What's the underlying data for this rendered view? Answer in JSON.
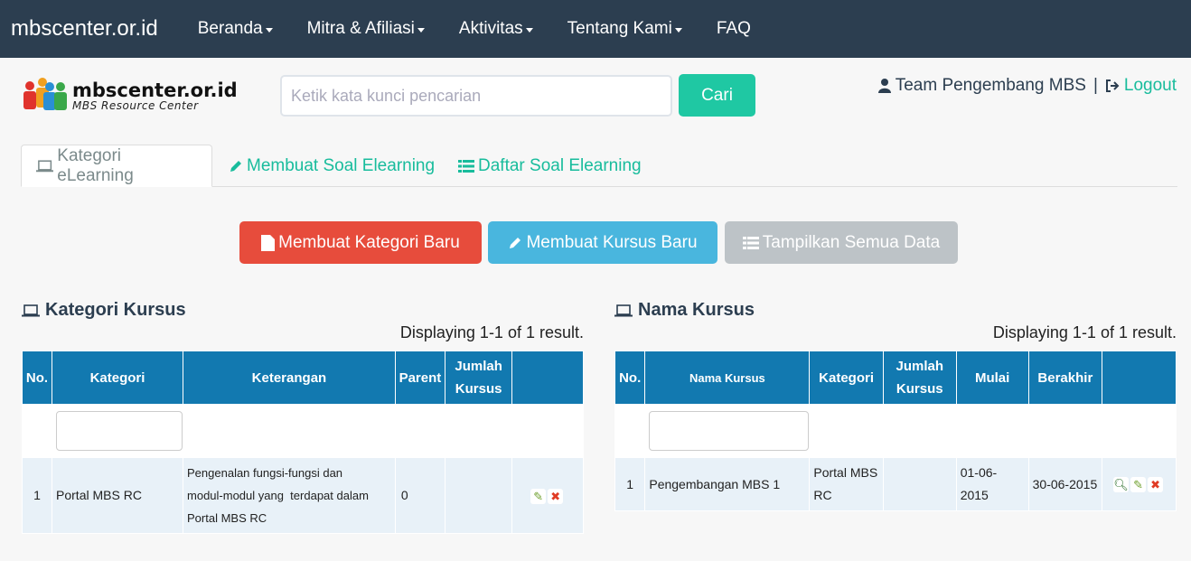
{
  "nav": {
    "brand": "mbscenter.or.id",
    "items": [
      {
        "label": "Beranda",
        "dropdown": true
      },
      {
        "label": "Mitra & Afiliasi",
        "dropdown": true
      },
      {
        "label": "Aktivitas",
        "dropdown": true
      },
      {
        "label": "Tentang Kami",
        "dropdown": true
      },
      {
        "label": "FAQ",
        "dropdown": false
      }
    ]
  },
  "header": {
    "logo_title": "mbscenter.or.id",
    "logo_sub": "MBS Resource Center",
    "search_placeholder": "Ketik kata kunci pencarian",
    "search_button": "Cari",
    "user_name": "Team Pengembang MBS",
    "separator": "|",
    "logout": "Logout"
  },
  "tabs": [
    {
      "label": "Kategori eLearning",
      "active": true,
      "icon": "laptop-icon"
    },
    {
      "label": "Membuat Soal Elearning",
      "active": false,
      "icon": "pencil-icon"
    },
    {
      "label": "Daftar Soal Elearning",
      "active": false,
      "icon": "list-icon"
    }
  ],
  "actions": {
    "new_category": "Membuat Kategori Baru",
    "new_course": "Membuat Kursus Baru",
    "show_all": "Tampilkan Semua Data"
  },
  "colors": {
    "navbar": "#2c3e50",
    "accent": "#18bc9c",
    "table_header": "#1279b0",
    "danger": "#e74c3c",
    "info": "#49b6de",
    "muted": "#bdc3c7"
  },
  "kategori": {
    "title": "Kategori Kursus",
    "summary": "Displaying 1-1 of 1 result.",
    "columns": [
      "No.",
      "Kategori",
      "Keterangan",
      "Parent",
      "Jumlah Kursus",
      ""
    ],
    "rows": [
      {
        "no": "1",
        "kategori": "Portal MBS RC",
        "keterangan_lines": [
          "Pengenalan fungsi-fungsi dan",
          "modul-modul yang  terdapat dalam",
          "Portal MBS RC"
        ],
        "parent": "0",
        "jumlah": ""
      }
    ]
  },
  "kursus": {
    "title": "Nama Kursus",
    "summary": "Displaying 1-1 of 1 result.",
    "columns": [
      "No.",
      "Nama Kursus",
      "Kategori",
      "Jumlah Kursus",
      "Mulai",
      "Berakhir",
      ""
    ],
    "rows": [
      {
        "no": "1",
        "nama": "Pengembangan MBS 1",
        "kategori_lines": [
          "Portal MBS",
          "RC"
        ],
        "jumlah": "",
        "mulai": "01-06-2015",
        "berakhir": "30-06-2015"
      }
    ]
  }
}
